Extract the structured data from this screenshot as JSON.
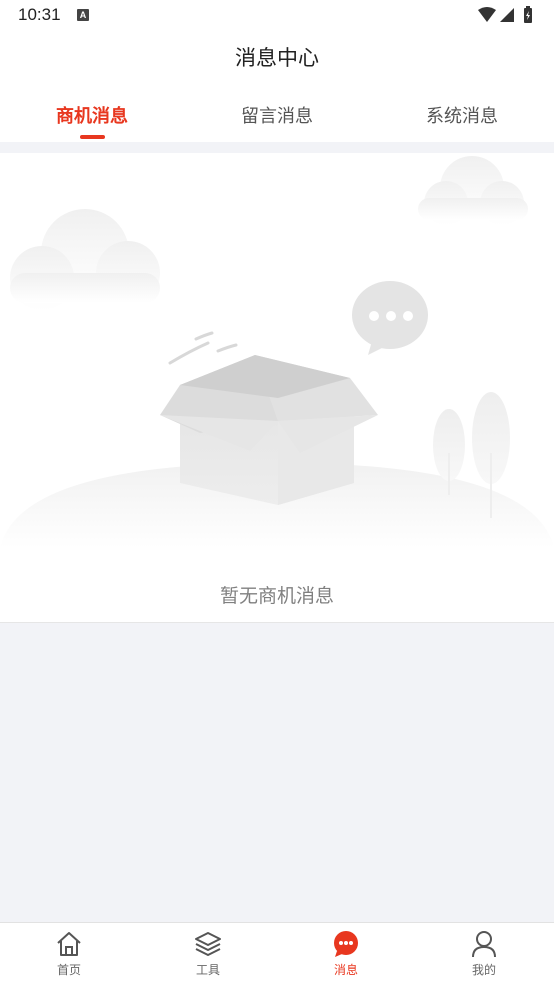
{
  "status_bar": {
    "time": "10:31",
    "notification_glyph": "A",
    "icons": [
      "wifi-icon",
      "signal-icon",
      "battery-icon"
    ]
  },
  "header": {
    "title": "消息中心"
  },
  "tabs": [
    {
      "label": "商机消息",
      "active": true
    },
    {
      "label": "留言消息",
      "active": false
    },
    {
      "label": "系统消息",
      "active": false
    }
  ],
  "empty_state": {
    "message": "暂无商机消息",
    "illustration": "empty-box-icon"
  },
  "bottom_nav": [
    {
      "label": "首页",
      "icon": "home-icon",
      "active": false
    },
    {
      "label": "工具",
      "icon": "layers-icon",
      "active": false
    },
    {
      "label": "消息",
      "icon": "message-icon",
      "active": true
    },
    {
      "label": "我的",
      "icon": "user-icon",
      "active": false
    }
  ],
  "colors": {
    "accent": "#e8371f",
    "background": "#f2f3f7"
  }
}
